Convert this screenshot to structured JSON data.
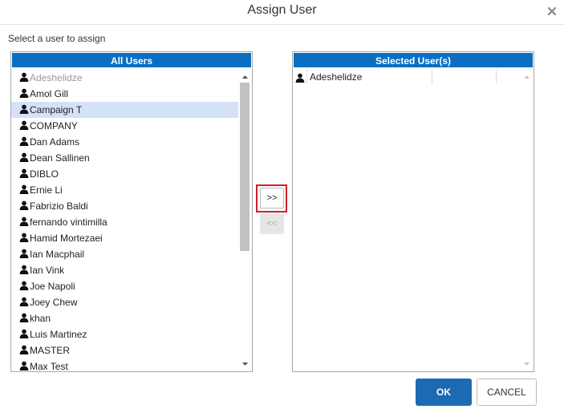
{
  "dialog": {
    "title": "Assign User",
    "subtitle": "Select a user to assign"
  },
  "all_users": {
    "header": "All Users",
    "items": [
      {
        "name": "Adeshelidze",
        "state": "disabled"
      },
      {
        "name": "Amol Gill",
        "state": "normal"
      },
      {
        "name": "Campaign T",
        "state": "selected"
      },
      {
        "name": "COMPANY",
        "state": "normal"
      },
      {
        "name": "Dan Adams",
        "state": "normal"
      },
      {
        "name": "Dean Sallinen",
        "state": "normal"
      },
      {
        "name": "DIBLO",
        "state": "normal"
      },
      {
        "name": "Ernie Li",
        "state": "normal"
      },
      {
        "name": "Fabrizio Baldi",
        "state": "normal"
      },
      {
        "name": "fernando vintimilla",
        "state": "normal"
      },
      {
        "name": "Hamid Mortezaei",
        "state": "normal"
      },
      {
        "name": "Ian Macphail",
        "state": "normal"
      },
      {
        "name": "Ian Vink",
        "state": "normal"
      },
      {
        "name": "Joe Napoli",
        "state": "normal"
      },
      {
        "name": "Joey Chew",
        "state": "normal"
      },
      {
        "name": "khan",
        "state": "normal"
      },
      {
        "name": "Luis Martinez",
        "state": "normal"
      },
      {
        "name": "MASTER",
        "state": "normal"
      },
      {
        "name": "Max Test",
        "state": "normal"
      }
    ]
  },
  "selected_users": {
    "header": "Selected User(s)",
    "items": [
      {
        "name": "Adeshelidze"
      }
    ]
  },
  "buttons": {
    "move_right": ">>",
    "move_left": "<<",
    "ok": "OK",
    "cancel": "CANCEL"
  },
  "colors": {
    "header_bg": "#0a6fc2",
    "selected_row": "#d3e2f7",
    "ok_bg": "#1d6ab4",
    "highlight": "#d0202a"
  },
  "icons": {
    "close": "close-icon",
    "user": "user-icon",
    "scroll_up": "arrow-up-icon",
    "scroll_down": "arrow-down-icon"
  }
}
